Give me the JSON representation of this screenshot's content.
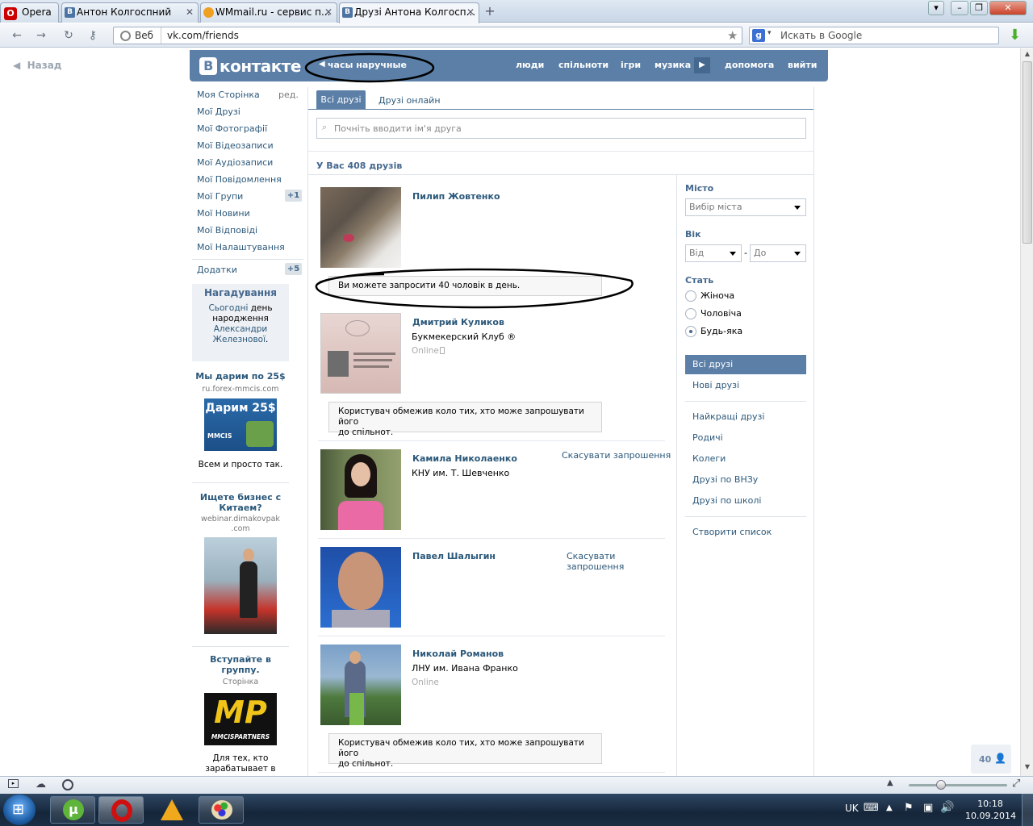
{
  "browser": {
    "tabs": [
      {
        "label": "Opera",
        "icon": "opera-icon"
      },
      {
        "label": "Антон Колгоспний",
        "icon": "vk-icon"
      },
      {
        "label": "WMmail.ru - сервис п...",
        "icon": "wmmail-icon"
      },
      {
        "label": "Друзі Антона Колгосп...",
        "icon": "vk-icon",
        "active": true
      }
    ],
    "web_label": "Веб",
    "url": "vk.com/friends",
    "search_placeholder": "Искать в Google"
  },
  "page": {
    "back_label": "Назад",
    "logo_text": "контакте",
    "logo_letter": "В",
    "status_text": "часы наручные",
    "topnav": [
      "люди",
      "спільноти",
      "ігри",
      "музика",
      "допомога",
      "вийти"
    ],
    "left_menu": [
      "Моя Сторінка",
      "Мої Друзі",
      "Мої Фотографії",
      "Мої Відеозаписи",
      "Мої Аудіозаписи",
      "Мої Повідомлення",
      "Мої Групи",
      "Мої Новини",
      "Мої Відповіді",
      "Мої Налаштування"
    ],
    "edit_label": "ред.",
    "groups_badge": "+1",
    "apps_label": "Додатки",
    "apps_badge": "+5",
    "reminder": {
      "title": "Нагадування",
      "line1_link": "Сьогодні",
      "line1_rest": " день",
      "line2": "народження",
      "line3_link": "Александри",
      "line4_link": "Железнової",
      "line4_rest": "."
    },
    "ads": [
      {
        "title": "Мы дарим по 25$",
        "domain": "ru.forex-mmcis.com",
        "banner": "Дарим 25$",
        "banner_sub": "MMCIS",
        "caption": "Всем и просто так."
      },
      {
        "title_line1": "Ищете бизнес с",
        "title_line2": "Китаем?",
        "domain_line1": "webinar.dimakovpak",
        "domain_line2": ".com"
      },
      {
        "title_line1": "Вступайте в",
        "title_line2": "группу.",
        "sub": "Сторінка",
        "banner": "MP",
        "banner_sub": "MMCISPARTNERS",
        "caption_line1": "Для тех, кто",
        "caption_line2": "зарабатывает в"
      }
    ],
    "tabs": [
      "Всі друзі",
      "Друзі онлайн"
    ],
    "search_placeholder": "Почніть вводити ім'я друга",
    "friends_count": "У Вас 408 друзів",
    "friends": [
      {
        "name": "Пилип Жовтенко",
        "photo": "wolves-photo",
        "notice": "Ви можете запросити 40 чоловік в день."
      },
      {
        "name": "Дмитрий Куликов",
        "sub": "Букмекерский Клуб ®",
        "online": "Online",
        "photo": "passport-photo",
        "notice_line1": "Користувач обмежив коло тих, хто може запрошувати його",
        "notice_line2": "до спільнот."
      },
      {
        "name": "Камила Николаенко",
        "sub": "КНУ им. Т. Шевченко",
        "action": "Скасувати запрошення",
        "photo": "girl-photo"
      },
      {
        "name": "Павел Шалыгин",
        "action_line1": "Скасувати",
        "action_line2": "запрошення",
        "photo": "man-photo"
      },
      {
        "name": "Николай Романов",
        "sub": "ЛНУ им. Ивана Франко",
        "online": "Online",
        "photo": "father-son-photo",
        "notice_line1": "Користувач обмежив коло тих, хто може запрошувати його",
        "notice_line2": "до спільнот."
      }
    ],
    "filters": {
      "city_label": "Місто",
      "city_select": "Вибір міста",
      "age_label": "Вік",
      "age_from": "Від",
      "age_dash": "-",
      "age_to": "До",
      "gender_label": "Стать",
      "genders": [
        "Жіноча",
        "Чоловіча",
        "Будь-яка"
      ],
      "gender_selected": "Будь-яка"
    },
    "right_menu": [
      "Всі друзі",
      "Нові друзі",
      "Найкращі друзі",
      "Родичі",
      "Колеги",
      "Друзі по ВНЗу",
      "Друзі по школі",
      "Створити список"
    ],
    "invite_counter": "40"
  },
  "taskbar": {
    "lang": "UK",
    "time": "10:18",
    "date": "10.09.2014"
  },
  "colors": {
    "vk_blue": "#5b7fa6",
    "link": "#2b587a",
    "annotation": "#000000"
  }
}
